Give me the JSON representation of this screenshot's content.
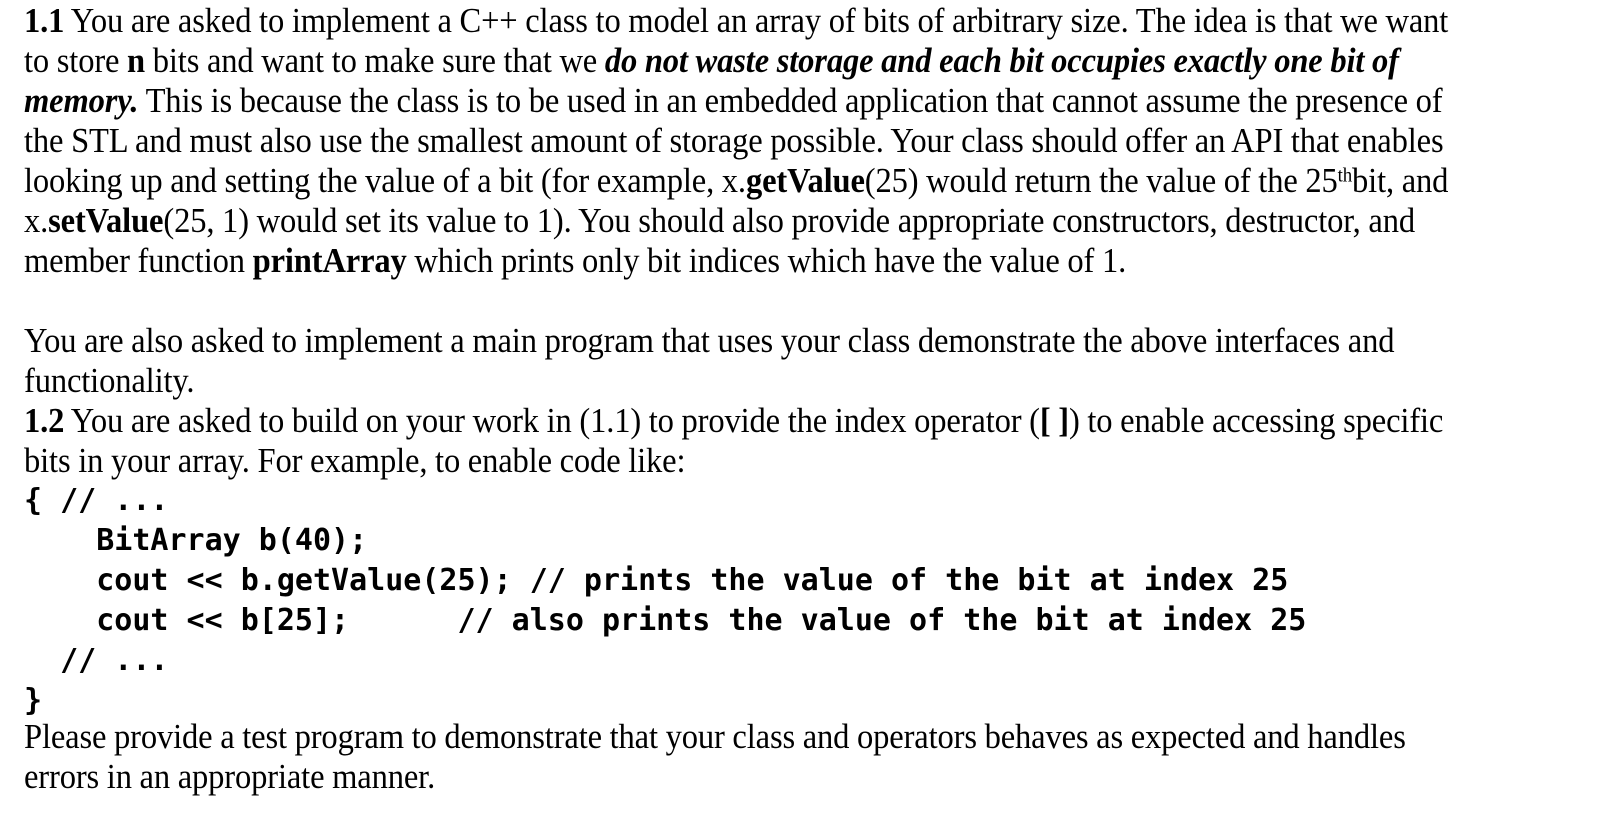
{
  "document": {
    "type": "assignment-text",
    "background_color": "#ffffff",
    "text_color": "#000000"
  },
  "q1_1": {
    "number": "1.1",
    "t1": " You are asked to implement a C++ class to model an array of bits of arbitrary size. The idea is that we want to store ",
    "n": "n",
    "t2": " bits and want to make sure that we ",
    "emph1": "do not waste storage and each bit occupies exactly one bit of memory.",
    "t3": " This is because the class is to be used in an embedded application that cannot assume the presence of the STL and must also use the smallest amount of storage possible. Your class should offer an API that enables looking up and setting the value of a bit (for example, x.",
    "getValue": "getValue",
    "t4": "(25) would return the value of the 25",
    "sup_th": "th",
    "t5": "bit, and x.",
    "setValue": "setValue",
    "t6": "(25, 1) would set its value to 1). You should also provide appropriate constructors, destructor, and member function ",
    "printArray": "printArray",
    "t7": " which prints only bit indices which have the value of 1."
  },
  "q1_1_note": {
    "text": "You are also asked to implement a main program that uses your class demonstrate the above interfaces and functionality."
  },
  "q1_2": {
    "number": "1.2",
    "t1": " You are asked to build on your work in (1.1) to provide the index operator (",
    "brackets": "[ ]",
    "t2": ") to enable accessing specific bits in your array. For example, to enable code like:"
  },
  "code": {
    "language": "cpp",
    "lines": [
      "{ // ...",
      "    BitArray b(40);",
      "    cout << b.getValue(25); // prints the value of the bit at index 25",
      "    cout << b[25];      // also prints the value of the bit at index 25",
      "  // ...",
      "}"
    ],
    "full_text": "{ // ...\n    BitArray b(40);\n    cout << b.getValue(25); // prints the value of the bit at index 25\n    cout << b[25];      // also prints the value of the bit at index 25\n  // ...\n}"
  },
  "closing": {
    "text": "Please provide a test program to demonstrate that your class and operators behaves as expected and handles errors in an appropriate manner."
  }
}
